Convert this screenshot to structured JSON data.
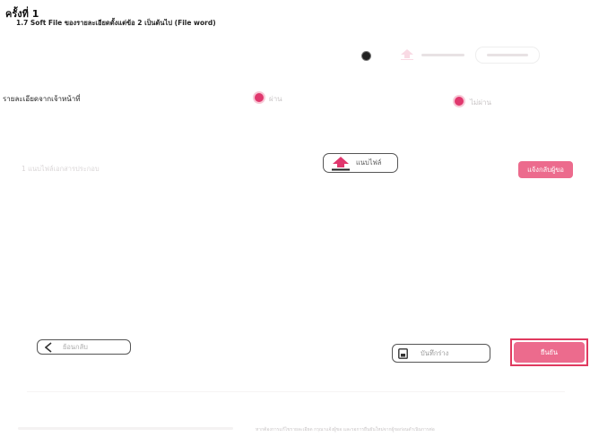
{
  "heading": "ครั้งที่ 1",
  "subheading": "1.7 Soft File ของรายละเอียดตั้งแต่ข้อ 2 เป็นต้นไป (File word)",
  "details_row": {
    "label": "รายละเอียดจากเจ้าหน้าที่",
    "option_one": "ผ่าน",
    "option_two": "ไม่ผ่าน"
  },
  "document": {
    "placeholder": "1  แนบไฟล์เอกสารประกอบ",
    "upload_label": "แนบไฟล์",
    "return_label": "แจ้งกลับผู้ขอ"
  },
  "actions": {
    "back_label": "ย้อนกลับ",
    "draft_label": "บันทึกร่าง",
    "confirm_label": "ยืนยัน"
  },
  "footer_note": "หากต้องการแก้ไขรายละเอียด กรุณาแจ้งผู้ขอ และรอการยืนยันใหม่จากผู้ขอก่อนดำเนินการต่อ",
  "colors": {
    "accent": "#ec6b8d",
    "radio": "#e0386e",
    "highlight_border": "#e03a5f"
  }
}
